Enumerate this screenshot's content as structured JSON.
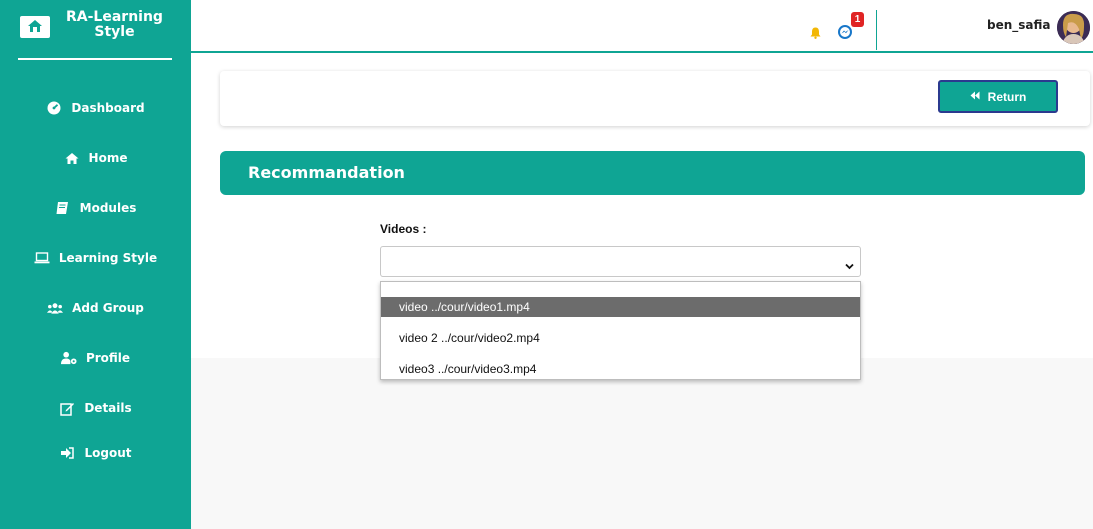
{
  "brand": {
    "line1": "RA-Learning",
    "line2": "Style"
  },
  "sidebar": {
    "items": [
      {
        "label": "Dashboard",
        "icon": "tachometer-icon"
      },
      {
        "label": "Home",
        "icon": "home-icon"
      },
      {
        "label": "Modules",
        "icon": "book-icon"
      },
      {
        "label": "Learning Style",
        "icon": "laptop-icon"
      },
      {
        "label": "Add Group",
        "icon": "users-icon"
      },
      {
        "label": "Profile",
        "icon": "user-cog-icon"
      },
      {
        "label": "Details",
        "icon": "edit-icon"
      },
      {
        "label": "Logout",
        "icon": "sign-out-icon"
      }
    ]
  },
  "topbar": {
    "notification_icon": "bell-icon",
    "messenger_icon": "messenger-icon",
    "message_count": "1",
    "username": "ben_safia"
  },
  "toolbar": {
    "return_label": "Return"
  },
  "section": {
    "title": "Recommandation"
  },
  "form": {
    "videos_label": "Videos :",
    "options": [
      "video ../cour/video1.mp4",
      "video 2 ../cour/video2.mp4",
      "video3 ../cour/video3.mp4"
    ],
    "highlighted_index": 0
  },
  "colors": {
    "accent": "#0fa594",
    "badge": "#e02424",
    "bell": "#f2b705",
    "return_border": "#2b3a8f"
  }
}
